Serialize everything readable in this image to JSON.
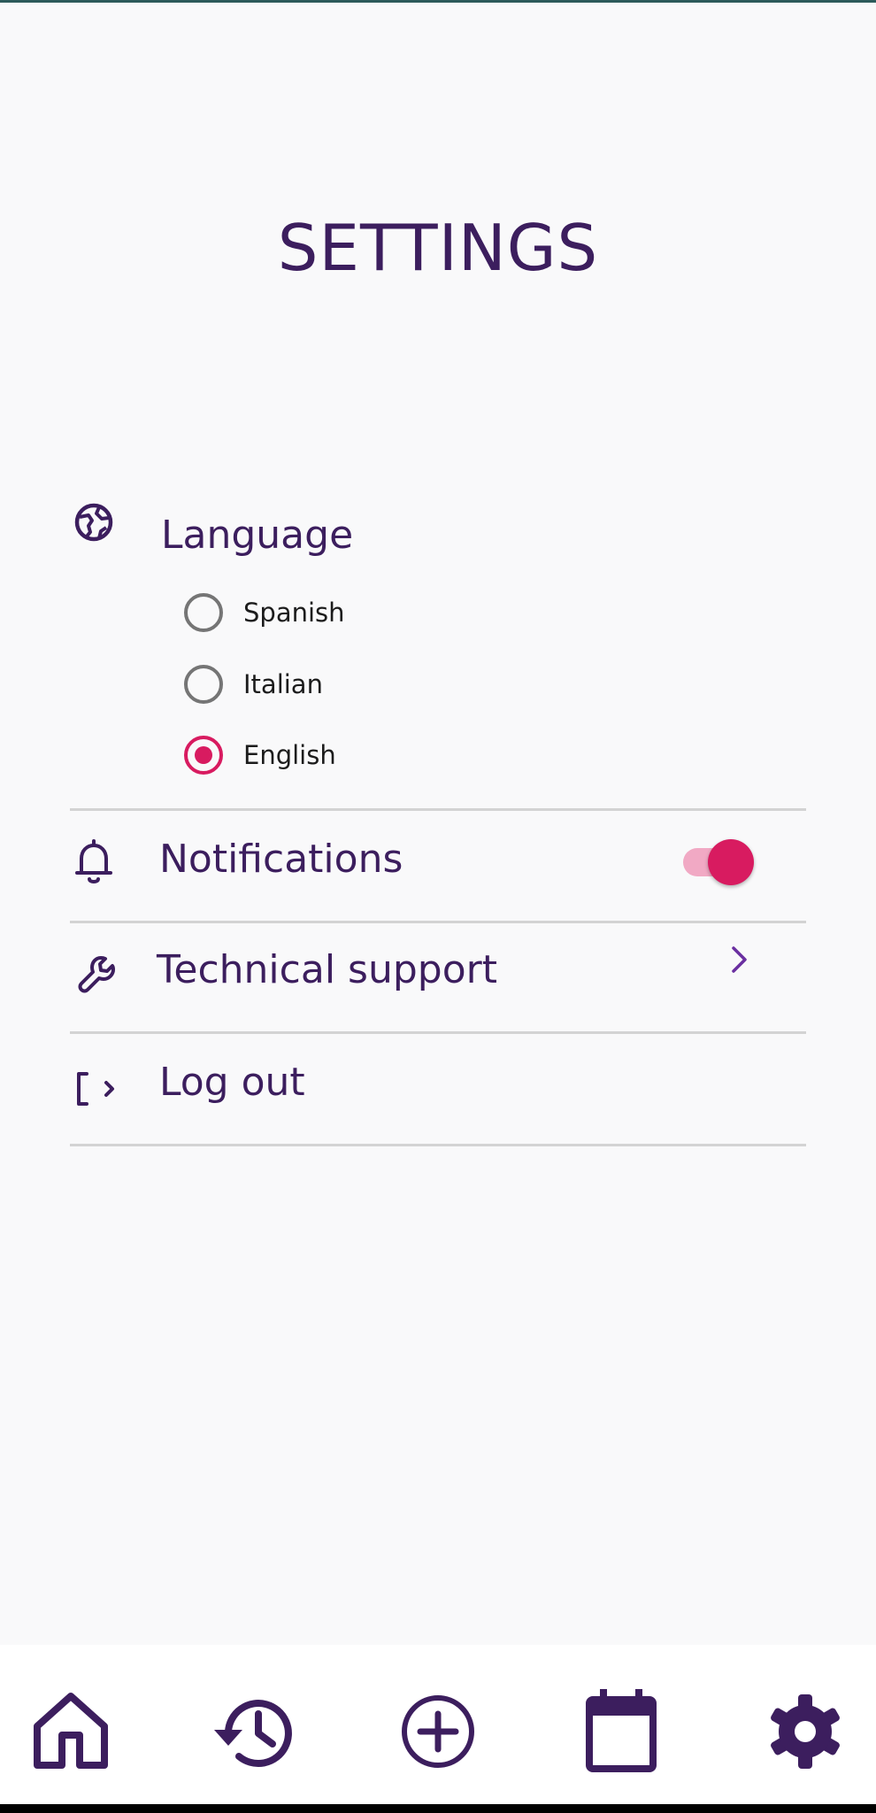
{
  "header": {
    "title": "SETTINGS"
  },
  "settings": {
    "language": {
      "label": "Language",
      "icon": "globe-icon",
      "options": [
        {
          "label": "Spanish",
          "selected": false
        },
        {
          "label": "Italian",
          "selected": false
        },
        {
          "label": "English",
          "selected": true
        }
      ]
    },
    "notifications": {
      "label": "Notifications",
      "icon": "bell-icon",
      "enabled": true
    },
    "technical_support": {
      "label": "Technical support",
      "icon": "wrench-icon"
    },
    "logout": {
      "label": "Log out",
      "icon": "logout-icon"
    }
  },
  "bottom_nav": {
    "items": [
      {
        "name": "home",
        "icon": "home-icon"
      },
      {
        "name": "history",
        "icon": "history-icon"
      },
      {
        "name": "add",
        "icon": "add-circle-icon"
      },
      {
        "name": "calendar",
        "icon": "calendar-icon"
      },
      {
        "name": "settings",
        "icon": "gear-icon",
        "active": true
      }
    ]
  },
  "colors": {
    "primary": "#3c1e5e",
    "accent": "#d81b60",
    "accent_light": "#f1a9c4",
    "background": "#f9f9fa",
    "divider": "#d3d3d3"
  }
}
